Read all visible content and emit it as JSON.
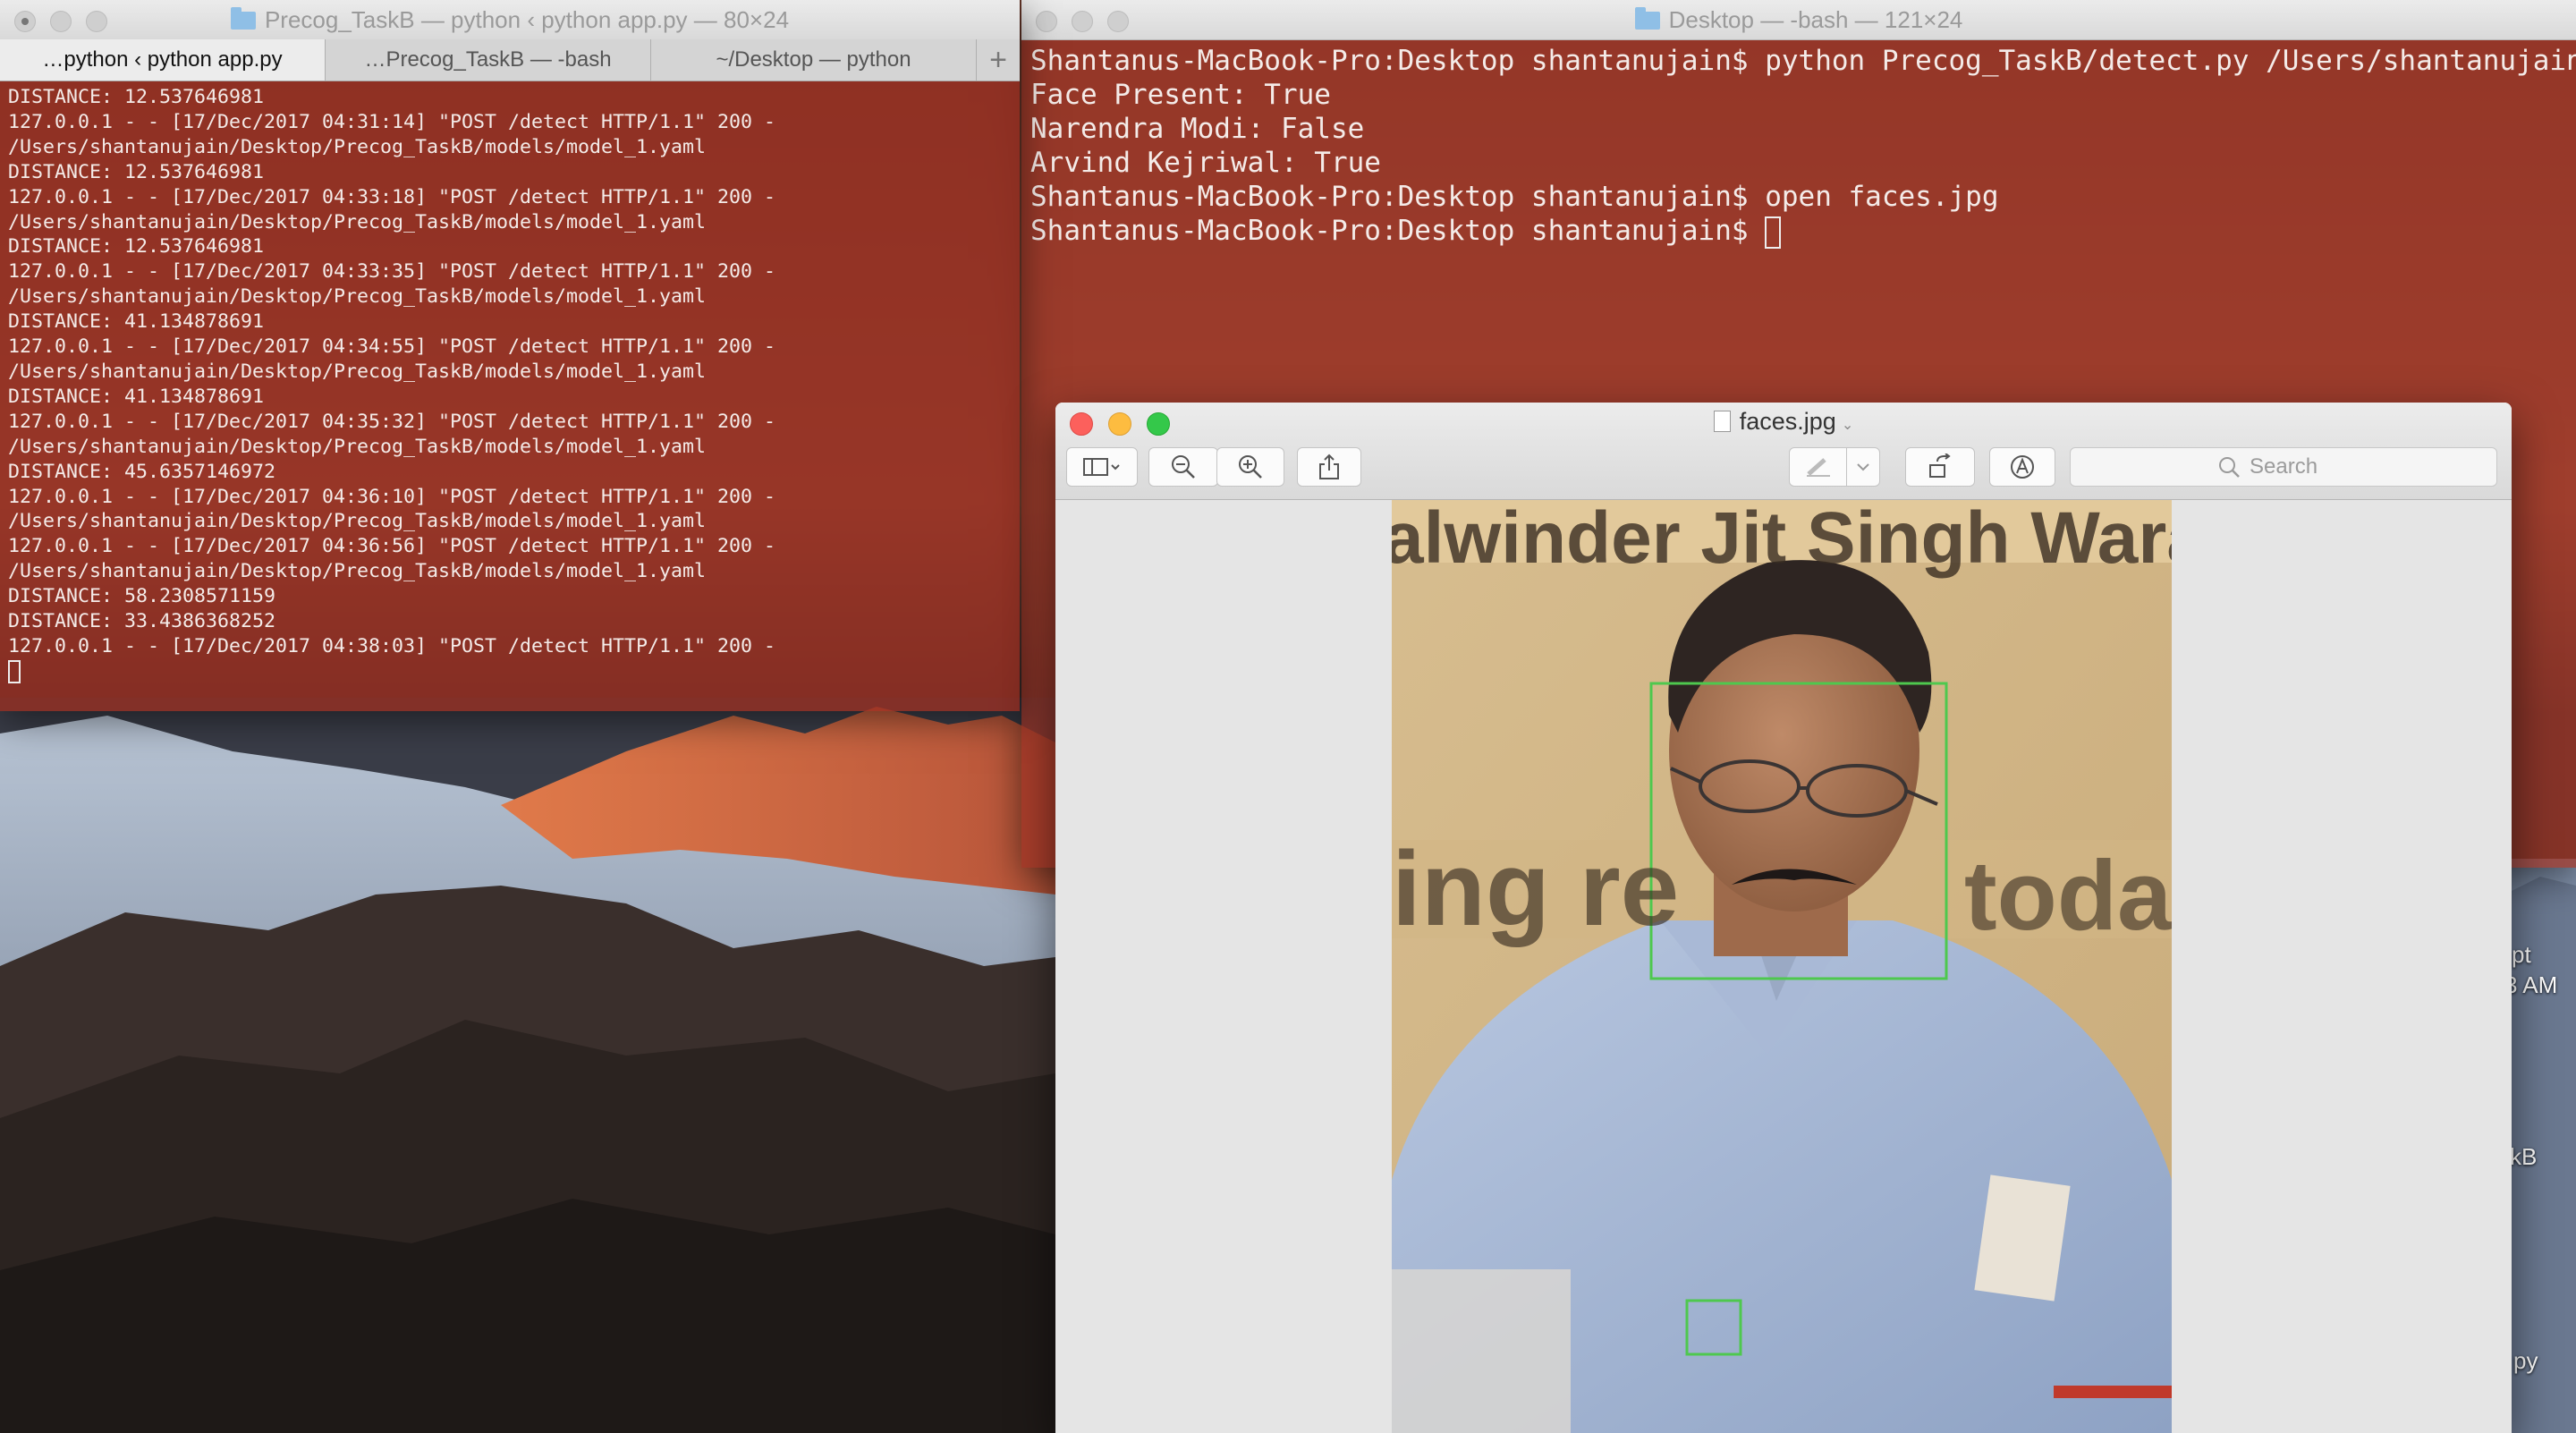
{
  "colors": {
    "terminal_tint": "#a3352a",
    "terminal_text": "#f4ebe8",
    "face_box": "#4ec84e",
    "close": "#fc605c",
    "minimize": "#fdbc40",
    "zoom": "#34c84a"
  },
  "terminal_left": {
    "title": "Precog_TaskB — python ‹ python app.py — 80×24",
    "tabs": [
      {
        "label": "…python ‹ python app.py",
        "active": true
      },
      {
        "label": "…Precog_TaskB — -bash",
        "active": false
      },
      {
        "label": "~/Desktop — python",
        "active": false
      }
    ],
    "new_tab_icon": "plus-icon",
    "lines": [
      "DISTANCE: 12.537646981",
      "127.0.0.1 - - [17/Dec/2017 04:31:14] \"POST /detect HTTP/1.1\" 200 -",
      "/Users/shantanujain/Desktop/Precog_TaskB/models/model_1.yaml",
      "DISTANCE: 12.537646981",
      "127.0.0.1 - - [17/Dec/2017 04:33:18] \"POST /detect HTTP/1.1\" 200 -",
      "/Users/shantanujain/Desktop/Precog_TaskB/models/model_1.yaml",
      "DISTANCE: 12.537646981",
      "127.0.0.1 - - [17/Dec/2017 04:33:35] \"POST /detect HTTP/1.1\" 200 -",
      "/Users/shantanujain/Desktop/Precog_TaskB/models/model_1.yaml",
      "DISTANCE: 41.134878691",
      "127.0.0.1 - - [17/Dec/2017 04:34:55] \"POST /detect HTTP/1.1\" 200 -",
      "/Users/shantanujain/Desktop/Precog_TaskB/models/model_1.yaml",
      "DISTANCE: 41.134878691",
      "127.0.0.1 - - [17/Dec/2017 04:35:32] \"POST /detect HTTP/1.1\" 200 -",
      "/Users/shantanujain/Desktop/Precog_TaskB/models/model_1.yaml",
      "DISTANCE: 45.6357146972",
      "127.0.0.1 - - [17/Dec/2017 04:36:10] \"POST /detect HTTP/1.1\" 200 -",
      "/Users/shantanujain/Desktop/Precog_TaskB/models/model_1.yaml",
      "127.0.0.1 - - [17/Dec/2017 04:36:56] \"POST /detect HTTP/1.1\" 200 -",
      "/Users/shantanujain/Desktop/Precog_TaskB/models/model_1.yaml",
      "DISTANCE: 58.2308571159",
      "DISTANCE: 33.4386368252",
      "127.0.0.1 - - [17/Dec/2017 04:38:03] \"POST /detect HTTP/1.1\" 200 -"
    ]
  },
  "terminal_right": {
    "title": "Desktop — -bash — 121×24",
    "lines": [
      "Shantanus-MacBook-Pro:Desktop shantanujain$ python Precog_TaskB/detect.py /Users/shantanujain/De",
      "Face Present: True",
      "Narendra Modi: False",
      "Arvind Kejriwal: True",
      "Shantanus-MacBook-Pro:Desktop shantanujain$ open faces.jpg"
    ],
    "prompt": "Shantanus-MacBook-Pro:Desktop shantanujain$ "
  },
  "preview": {
    "filename": "faces.jpg",
    "toolbar": {
      "sidebar_icon": "sidebar-icon",
      "zoom_out_icon": "zoom-out-icon",
      "zoom_in_icon": "zoom-in-icon",
      "share_icon": "share-icon",
      "markup_pen_icon": "pen-icon",
      "rotate_icon": "rotate-icon",
      "annotate_icon": "markup-circle-icon",
      "search_placeholder": "Search"
    },
    "photo_banner_lines": [
      "alwinder Jit Singh Wara",
      "ing re",
      "today"
    ]
  },
  "desktop_clipped_labels": [
    "pt",
    "3 AM",
    "kB",
    "py"
  ]
}
